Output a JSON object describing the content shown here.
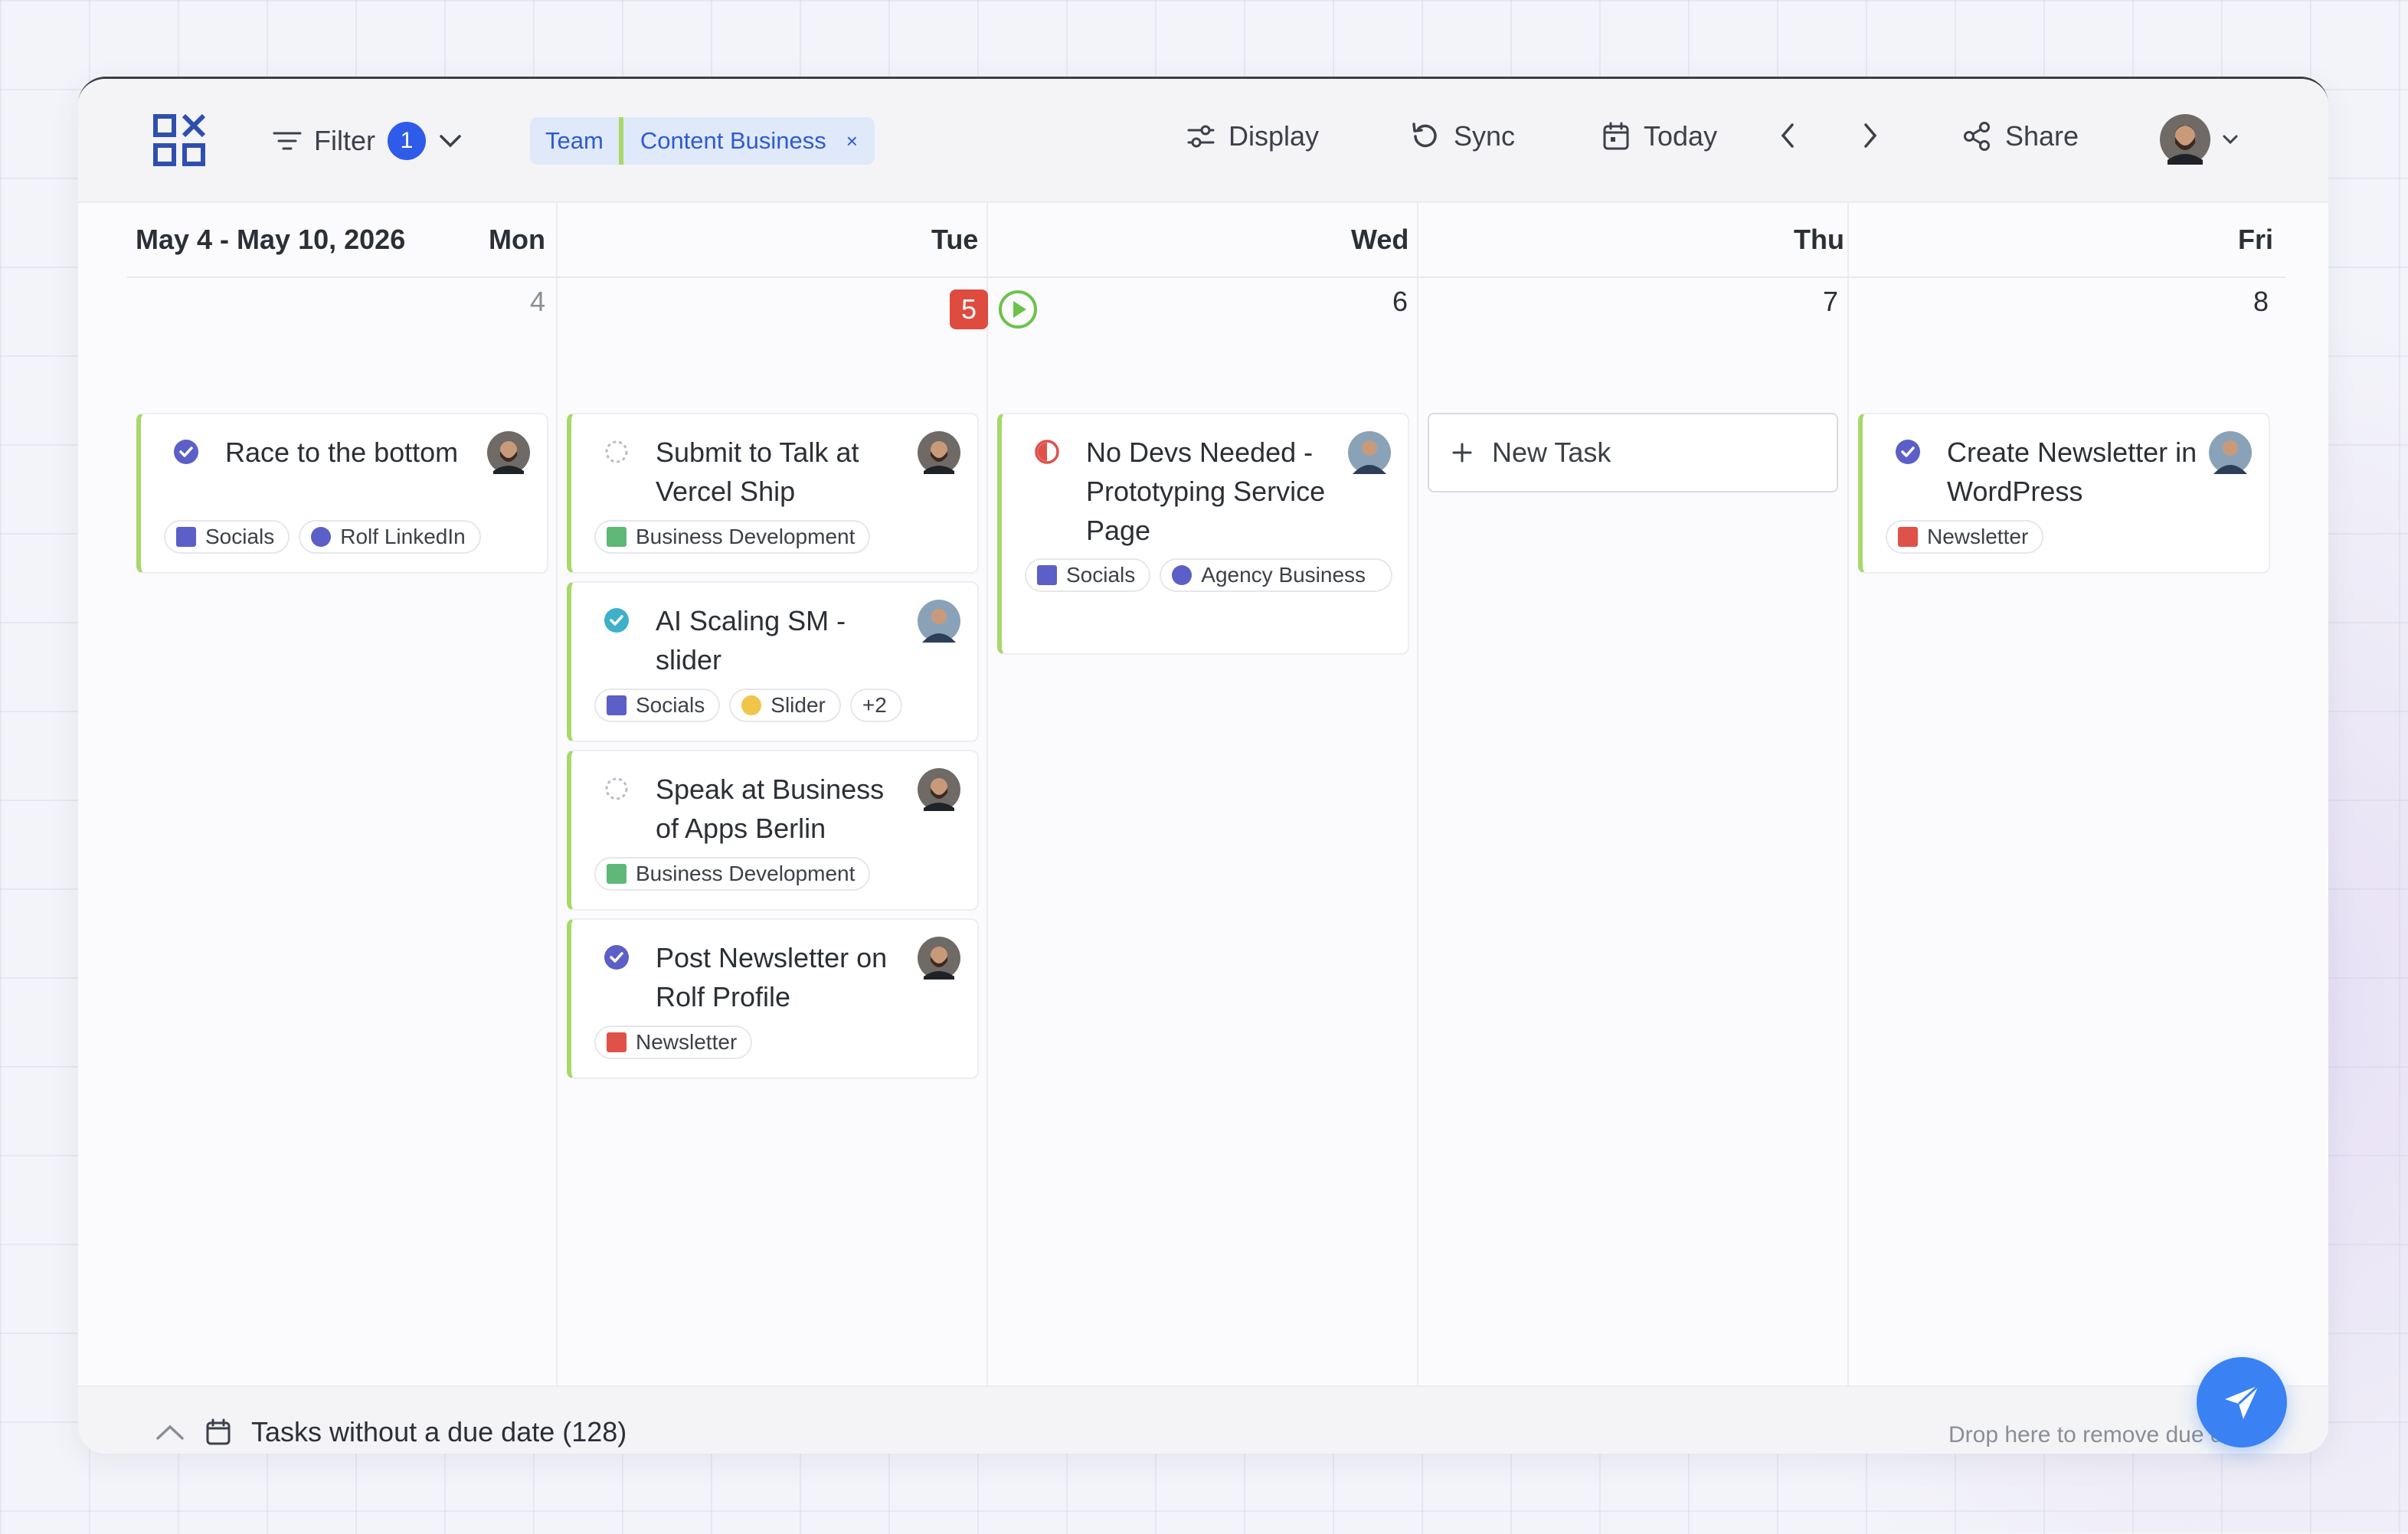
{
  "toolbar": {
    "filter_label": "Filter",
    "filter_count": "1",
    "chip_team": "Team",
    "chip_content": "Content Business",
    "chip_remove": "×",
    "display_label": "Display",
    "sync_label": "Sync",
    "today_label": "Today",
    "share_label": "Share"
  },
  "calendar": {
    "range": "May 4 - May 10, 2026",
    "days": [
      {
        "name": "Mon",
        "num": "4"
      },
      {
        "name": "Tue",
        "num": "5"
      },
      {
        "name": "Wed",
        "num": "6"
      },
      {
        "name": "Thu",
        "num": "7"
      },
      {
        "name": "Fri",
        "num": "8"
      }
    ],
    "new_task_label": "New Task"
  },
  "tasks": {
    "mon_1": {
      "title": "Race to the bottom",
      "status": "done-purple",
      "tags": [
        "Socials",
        "Rolf LinkedIn"
      ]
    },
    "tue_1": {
      "title": "Submit to Talk at Vercel Ship",
      "status": "todo",
      "tags": [
        "Business Development"
      ]
    },
    "tue_2": {
      "title": "AI Scaling SM - slider",
      "status": "done-teal",
      "tags": [
        "Socials",
        "Slider",
        "+2"
      ]
    },
    "tue_3": {
      "title": "Speak at Business of Apps Berlin",
      "status": "todo",
      "tags": [
        "Business Development"
      ]
    },
    "tue_4": {
      "title": "Post Newsletter on Rolf Profile",
      "status": "done-purple",
      "tags": [
        "Newsletter"
      ]
    },
    "wed_1": {
      "title": "No Devs Needed - Prototyping Service Page",
      "status": "in-progress",
      "tags": [
        "Socials",
        "Agency Business"
      ]
    },
    "fri_1": {
      "title": "Create Newsletter in WordPress",
      "status": "done-purple",
      "tags": [
        "Newsletter"
      ]
    }
  },
  "tag_colors": {
    "Socials": "#5b5fc7",
    "Rolf LinkedIn": "#5b5fc7",
    "Business Development": "#5fb878",
    "Slider": "#f0c64a",
    "Newsletter": "#df5149",
    "Agency Business": "#5b5fc7"
  },
  "footer": {
    "no_due_label": "Tasks without a due date (128)",
    "drop_label": "Drop here to remove due date"
  },
  "colors": {
    "accent": "#2f5bea",
    "today_badge": "#df4b3f",
    "card_stripe": "#a6d96a",
    "fab": "#3a82f3"
  }
}
